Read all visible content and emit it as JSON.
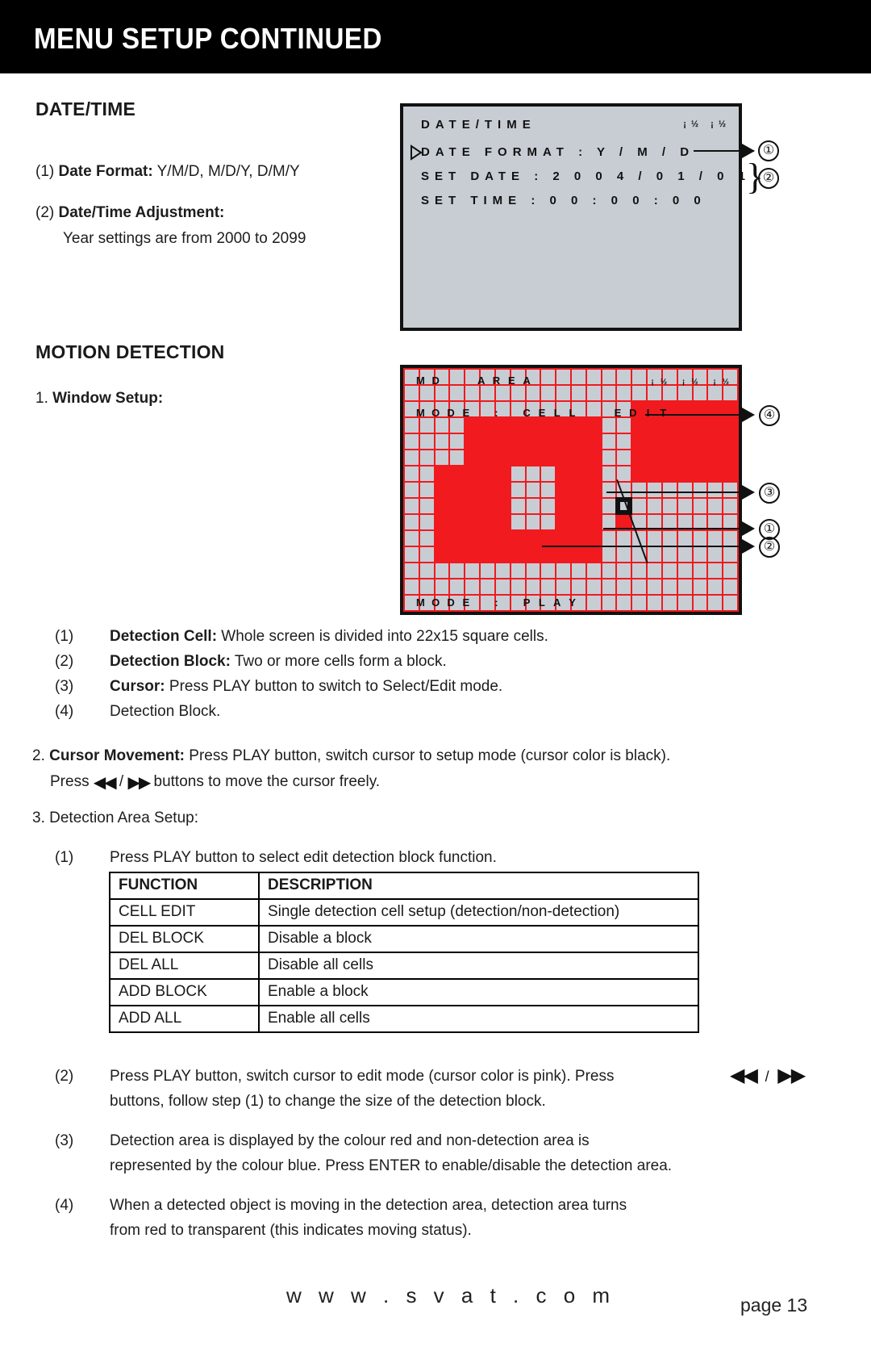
{
  "header": {
    "title": "MENU SETUP CONTINUED"
  },
  "sections": {
    "datetime": {
      "heading": "DATE/TIME",
      "items": [
        {
          "num": "(1)",
          "label": "Date Format:",
          "text": " Y/M/D, M/D/Y, D/M/Y"
        },
        {
          "num": "(2)",
          "label": "Date/Time Adjustment:",
          "text": ""
        }
      ],
      "sub_text": "Year settings are from 2000 to 2099"
    },
    "motion": {
      "heading": "MOTION DETECTION",
      "step1_label": "1.",
      "step1_text": "Window Setup:",
      "legend": [
        {
          "num": "(1)",
          "label": "Detection Cell:",
          "text": " Whole screen is divided into 22x15 square cells."
        },
        {
          "num": "(2)",
          "label": "Detection Block:",
          "text": " Two or more cells form a block."
        },
        {
          "num": "(3)",
          "label": "Cursor:",
          "text": " Press PLAY  button to switch to Select/Edit mode."
        },
        {
          "num": "(4)",
          "label": "",
          "text": "Detection Block."
        }
      ],
      "step2_num": "2.",
      "step2_label": "Cursor Movement:",
      "step2_text": " Press PLAY button, switch cursor to setup mode (cursor color is black).",
      "step2_line2_a": "Press",
      "step2_line2_b": "/",
      "step2_line2_c": "buttons to move the cursor freely.",
      "step3_num": "3.",
      "step3_text": "Detection Area Setup:",
      "sub1_num": "(1)",
      "sub1_text": "Press PLAY button to select edit detection block function.",
      "sub2_num": "(2)",
      "sub2_line1": "Press PLAY button, switch cursor to edit mode (cursor color is pink). Press",
      "sub2_line2": "buttons, follow step (1) to change the size of the detection block.",
      "sub3_num": "(3)",
      "sub3_line1": "Detection area is displayed by the colour red and non-detection area is",
      "sub3_line2": "represented by the colour blue. Press ENTER to enable/disable the detection area.",
      "sub4_num": "(4)",
      "sub4_line1": "When a detected object is moving in the detection area, detection area turns",
      "sub4_line2": "from red to transparent (this indicates moving status)."
    }
  },
  "osd_datetime": {
    "title": "DATE/TIME",
    "corner_glyphs": "¡½ ¡½",
    "rows": [
      "DATE    FORMAT : Y / M / D",
      "SET   DATE :  2 0 0 4 / 0 1 / 0 1",
      "SET   TIME :      0 0 : 0 0 : 0 0"
    ],
    "callouts": [
      "①",
      "②"
    ]
  },
  "osd_md": {
    "title": "MD  AREA",
    "corner_glyphs": "¡½ ¡½ ¡½",
    "mode_line": "MODE : CELL  EDIT",
    "bottom_line": "MODE : PLAY",
    "callouts": [
      "④",
      "③",
      "①",
      "②"
    ],
    "grid": {
      "cols": 22,
      "rows": 15,
      "cell_colors": {
        "off": "#c8cdd4",
        "on": "#f01a1f",
        "line": "#f01a1f"
      },
      "filled_cells": [
        [
          3,
          4
        ],
        [
          3,
          5
        ],
        [
          3,
          6
        ],
        [
          3,
          7
        ],
        [
          3,
          8
        ],
        [
          3,
          9
        ],
        [
          3,
          10
        ],
        [
          3,
          11
        ],
        [
          3,
          12
        ],
        [
          2,
          15
        ],
        [
          2,
          16
        ],
        [
          2,
          17
        ],
        [
          2,
          18
        ],
        [
          2,
          19
        ],
        [
          2,
          20
        ],
        [
          2,
          21
        ],
        [
          3,
          15
        ],
        [
          3,
          16
        ],
        [
          3,
          17
        ],
        [
          3,
          18
        ],
        [
          3,
          19
        ],
        [
          3,
          20
        ],
        [
          3,
          21
        ],
        [
          4,
          4
        ],
        [
          4,
          5
        ],
        [
          4,
          6
        ],
        [
          4,
          7
        ],
        [
          4,
          8
        ],
        [
          4,
          9
        ],
        [
          4,
          10
        ],
        [
          4,
          11
        ],
        [
          4,
          12
        ],
        [
          4,
          15
        ],
        [
          4,
          16
        ],
        [
          4,
          17
        ],
        [
          4,
          18
        ],
        [
          4,
          19
        ],
        [
          4,
          20
        ],
        [
          4,
          21
        ],
        [
          5,
          4
        ],
        [
          5,
          5
        ],
        [
          5,
          6
        ],
        [
          5,
          7
        ],
        [
          5,
          8
        ],
        [
          5,
          9
        ],
        [
          5,
          10
        ],
        [
          5,
          11
        ],
        [
          5,
          12
        ],
        [
          5,
          15
        ],
        [
          5,
          16
        ],
        [
          5,
          17
        ],
        [
          5,
          18
        ],
        [
          5,
          19
        ],
        [
          5,
          20
        ],
        [
          5,
          21
        ],
        [
          6,
          2
        ],
        [
          6,
          3
        ],
        [
          6,
          4
        ],
        [
          6,
          5
        ],
        [
          6,
          6
        ],
        [
          6,
          10
        ],
        [
          6,
          11
        ],
        [
          6,
          12
        ],
        [
          6,
          15
        ],
        [
          6,
          16
        ],
        [
          6,
          17
        ],
        [
          6,
          18
        ],
        [
          6,
          19
        ],
        [
          6,
          20
        ],
        [
          6,
          21
        ],
        [
          7,
          2
        ],
        [
          7,
          3
        ],
        [
          7,
          4
        ],
        [
          7,
          5
        ],
        [
          7,
          6
        ],
        [
          7,
          10
        ],
        [
          7,
          11
        ],
        [
          7,
          12
        ],
        [
          8,
          2
        ],
        [
          8,
          3
        ],
        [
          8,
          4
        ],
        [
          8,
          5
        ],
        [
          8,
          6
        ],
        [
          8,
          10
        ],
        [
          8,
          11
        ],
        [
          8,
          12
        ],
        [
          9,
          2
        ],
        [
          9,
          3
        ],
        [
          9,
          4
        ],
        [
          9,
          5
        ],
        [
          9,
          6
        ],
        [
          9,
          10
        ],
        [
          9,
          11
        ],
        [
          9,
          12
        ],
        [
          9,
          14
        ],
        [
          10,
          2
        ],
        [
          10,
          3
        ],
        [
          10,
          4
        ],
        [
          10,
          5
        ],
        [
          10,
          6
        ],
        [
          10,
          7
        ],
        [
          10,
          8
        ],
        [
          10,
          9
        ],
        [
          10,
          10
        ],
        [
          10,
          11
        ],
        [
          10,
          12
        ],
        [
          11,
          2
        ],
        [
          11,
          3
        ],
        [
          11,
          4
        ],
        [
          11,
          5
        ],
        [
          11,
          6
        ],
        [
          11,
          7
        ],
        [
          11,
          8
        ],
        [
          11,
          9
        ],
        [
          11,
          10
        ],
        [
          11,
          11
        ],
        [
          11,
          12
        ]
      ],
      "cursor_cell": [
        8,
        14
      ]
    }
  },
  "table": {
    "headers": [
      "FUNCTION",
      "DESCRIPTION"
    ],
    "rows": [
      [
        "CELL EDIT",
        "Single detection cell setup (detection/non-detection)"
      ],
      [
        "DEL BLOCK",
        "Disable a block"
      ],
      [
        "DEL ALL",
        "Disable all cells"
      ],
      [
        "ADD BLOCK",
        "Enable a block"
      ],
      [
        "ADD ALL",
        "Enable all cells"
      ]
    ]
  },
  "footer": {
    "url": "w w w . s v a t . c o m",
    "page": "page 13"
  }
}
